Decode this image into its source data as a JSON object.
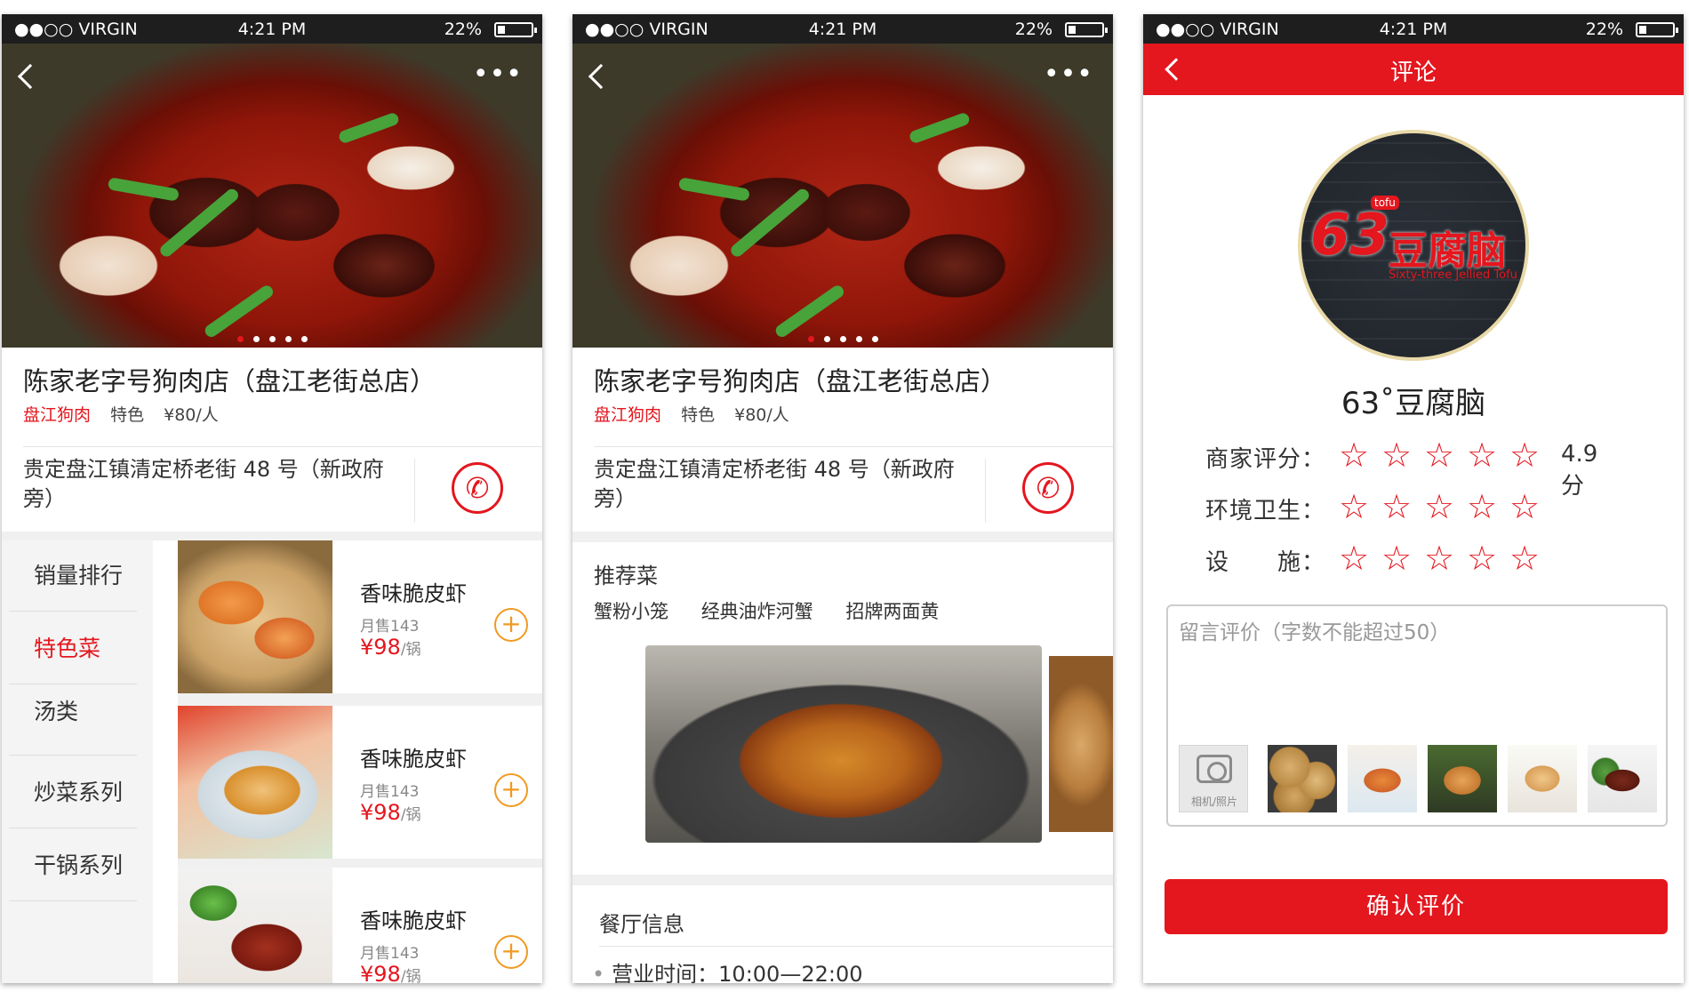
{
  "status": {
    "carrier": "●●○○ VIRGIN",
    "time": "4:21 PM",
    "battery": "22%"
  },
  "shop": {
    "title": "陈家老字号狗肉店（盘江老街总店）",
    "category": "盘江狗肉",
    "tag": "特色",
    "price": "¥80/人",
    "address": "贵定盘江镇清定桥老街 48 号（新政府旁）"
  },
  "menu": {
    "categories": [
      "销量排行",
      "特色菜",
      "汤类",
      "炒菜系列",
      "干锅系列"
    ],
    "active": 1,
    "dishes": [
      {
        "name": "香味脆皮虾",
        "sold": "月售143",
        "price": "¥98",
        "unit": "/锅"
      },
      {
        "name": "香味脆皮虾",
        "sold": "月售143",
        "price": "¥98",
        "unit": "/锅"
      },
      {
        "name": "香味脆皮虾",
        "sold": "月售143",
        "price": "¥98",
        "unit": "/锅"
      }
    ]
  },
  "detail": {
    "recommend_title": "推荐菜",
    "recommend": [
      "蟹粉小笼",
      "经典油炸河蟹",
      "招牌两面黄"
    ],
    "info_title": "餐厅信息",
    "hours": "营业时间：10:00—22:00"
  },
  "review": {
    "header": "评论",
    "logo": {
      "tofu": "tofu",
      "num": "63",
      "cn": "豆腐脑",
      "en": "Sixty-three Jellied Tofu"
    },
    "shop_name": "63˚豆腐脑",
    "ratings": [
      {
        "label": "商家评分：",
        "value": "4.9分"
      },
      {
        "label": "环境卫生：",
        "value": ""
      },
      {
        "label": "设　　施：",
        "value": ""
      }
    ],
    "placeholder": "留言评价（字数不能超过50）",
    "camera_label": "相机/照片",
    "confirm": "确认评价"
  },
  "colors": {
    "accent": "#e4161e",
    "add": "#f09a22"
  },
  "icons": {
    "back": "chevron-left-icon",
    "more": "more-icon",
    "phone": "phone-icon",
    "star": "star-outline-icon",
    "camera": "camera-icon",
    "add": "plus-circle-icon"
  }
}
